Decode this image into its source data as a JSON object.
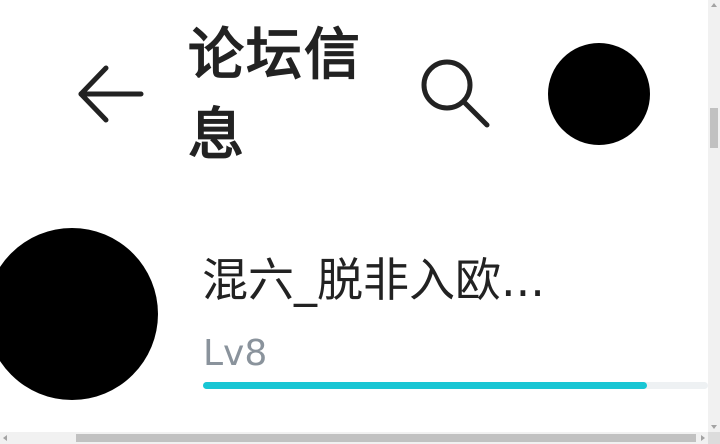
{
  "header": {
    "back_icon": "arrow-left-icon",
    "title": "论坛信息",
    "search_icon": "search-icon",
    "avatar_color": "#000000"
  },
  "profile": {
    "avatar_color": "#000000",
    "name": "混六_脱非入欧...",
    "level": "Lv8",
    "level_progress": 0.88,
    "progress_color": "#18c6d4",
    "track_color": "#eef1f3"
  },
  "colors": {
    "text_primary": "#222222",
    "text_secondary": "#8a939c",
    "background": "#ffffff"
  }
}
